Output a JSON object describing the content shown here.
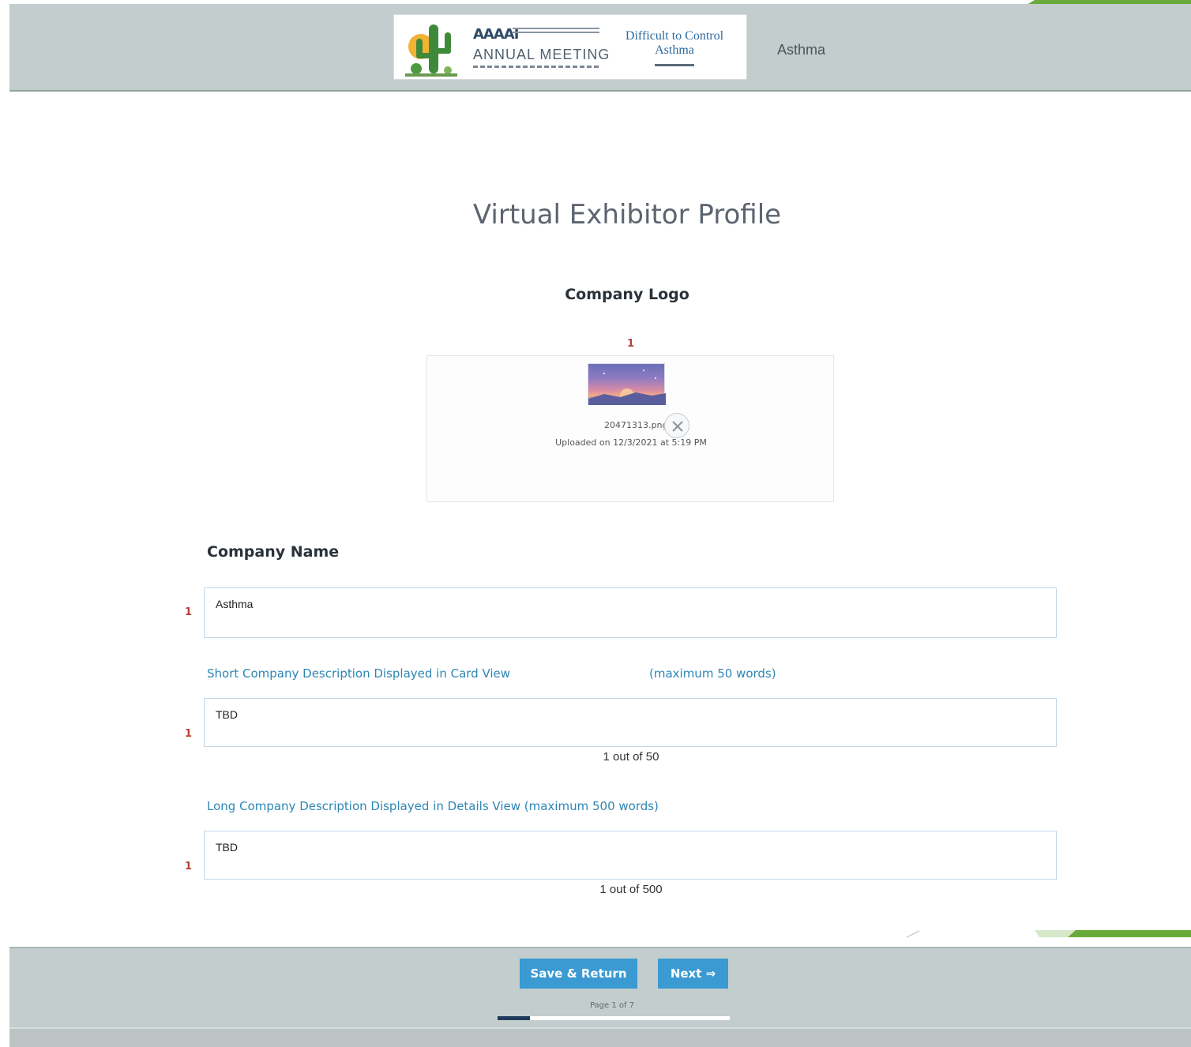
{
  "header": {
    "title": "Asthma",
    "banner": {
      "org": "AAAAI",
      "meeting": "ANNUAL MEETING",
      "title_line1": "Difficult to Control",
      "title_line2": "Asthma"
    }
  },
  "page": {
    "title": "Virtual Exhibitor Profile"
  },
  "logo": {
    "heading": "Company Logo",
    "file_name": "20471313.png",
    "uploaded": "Uploaded on 12/3/2021 at 5:19 PM"
  },
  "company_name": {
    "label": "Company Name",
    "value": "Asthma"
  },
  "short_description": {
    "label": "Short Company Description Displayed in Card View",
    "limit_note": "(maximum 50 words)",
    "value": "TBD",
    "counter": "1 out of 50"
  },
  "long_description": {
    "label": "Long Company Description Displayed in Details View (maximum 500 words)",
    "value": "TBD",
    "counter": "1 out of 500"
  },
  "required_marker": "1",
  "footer": {
    "save_label": "Save & Return",
    "next_label": "Next ⇒",
    "page_indicator": "Page 1 of 7",
    "progress_fraction": 0.14
  },
  "colors": {
    "header_bg": "#c3cdcd",
    "accent_blue": "#3a9ad1",
    "label_blue": "#2d86b5",
    "required_red": "#b5433a",
    "deco_green": "#6aaa3a"
  }
}
